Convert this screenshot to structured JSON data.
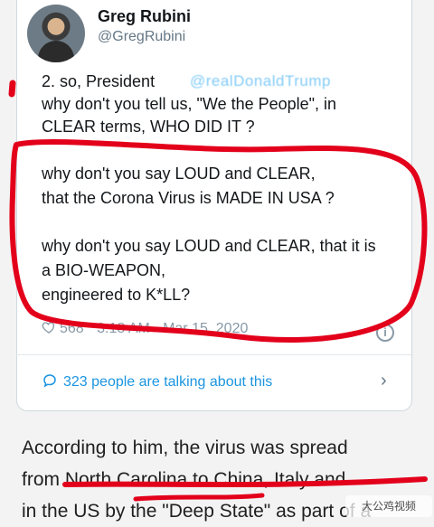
{
  "tweet": {
    "name": "Greg Rubini",
    "handle": "@GregRubini",
    "mention_fragment": "@realDonaldTrump",
    "lines": [
      "2. so, President",
      "why don't you tell us, \"We the People\", in",
      "CLEAR terms, WHO DID IT ?",
      "why don't you say LOUD and CLEAR,",
      "that the Corona Virus is MADE IN USA ?",
      "why don't you say LOUD and CLEAR, that it is",
      "a BIO-WEAPON,",
      "engineered to K*LL?"
    ],
    "likes": "568",
    "time_date": "3:18 AM · Mar 15, 2020",
    "talking": "323 people are talking about this"
  },
  "article": {
    "lines": [
      "According to him, the virus was spread",
      "from North Carolina to China, Italy and",
      "in the US by the \"Deep State\" as part of a"
    ]
  },
  "watermark": {
    "text": "大公鸡视频"
  },
  "colors": {
    "annotation_red": "#e3001b",
    "link_blue": "#1b95e0",
    "meta_gray": "#8899a6"
  }
}
